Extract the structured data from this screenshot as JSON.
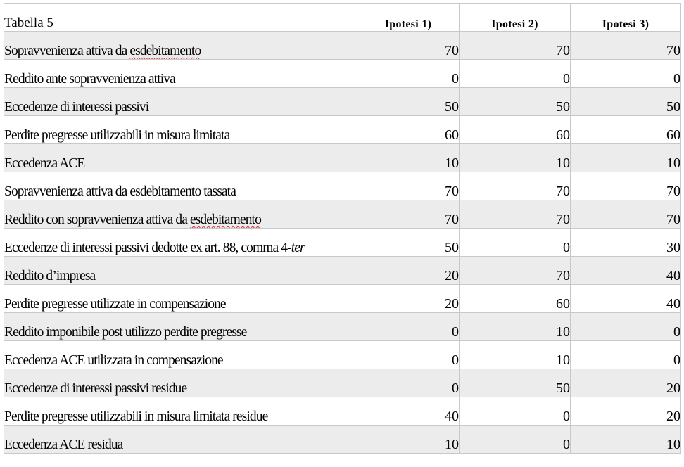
{
  "table": {
    "title": "Tabella 5",
    "headers": [
      "Ipotesi 1)",
      "Ipotesi 2)",
      "Ipotesi 3)"
    ],
    "rows": [
      {
        "label": "Sopravvenienza attiva da esdebitamento",
        "values": [
          "70",
          "70",
          "70"
        ]
      },
      {
        "label": "Reddito ante sopravvenienza attiva",
        "values": [
          "0",
          "0",
          "0"
        ]
      },
      {
        "label": "Eccedenze di interessi passivi",
        "values": [
          "50",
          "50",
          "50"
        ]
      },
      {
        "label": "Perdite pregresse utilizzabili in misura limitata",
        "values": [
          "60",
          "60",
          "60"
        ]
      },
      {
        "label": "Eccedenza ACE",
        "values": [
          "10",
          "10",
          "10"
        ]
      },
      {
        "label": "Sopravvenienza attiva da esdebitamento tassata",
        "values": [
          "70",
          "70",
          "70"
        ]
      },
      {
        "label": "Reddito con sopravvenienza attiva da esdebitamento",
        "values": [
          "70",
          "70",
          "70"
        ]
      },
      {
        "label": "Eccedenze di interessi passivi dedotte ex art. 88, comma 4-",
        "label_italic": "ter",
        "values": [
          "50",
          "0",
          "30"
        ]
      },
      {
        "label": "Reddito d’impresa",
        "values": [
          "20",
          "70",
          "40"
        ]
      },
      {
        "label": "Perdite pregresse utilizzate in compensazione",
        "values": [
          "20",
          "60",
          "40"
        ]
      },
      {
        "label": "Reddito imponibile post utilizzo perdite pregresse",
        "values": [
          "0",
          "10",
          "0"
        ]
      },
      {
        "label": "Eccedenza ACE utilizzata in compensazione",
        "values": [
          "0",
          "10",
          "0"
        ]
      },
      {
        "label": "Eccedenze di interessi passivi residue",
        "values": [
          "0",
          "50",
          "20"
        ]
      },
      {
        "label": "Perdite pregresse utilizzabili in misura limitata residue",
        "values": [
          "40",
          "0",
          "20"
        ]
      },
      {
        "label": "Eccedenza ACE residua",
        "values": [
          "10",
          "0",
          "10"
        ]
      }
    ]
  }
}
